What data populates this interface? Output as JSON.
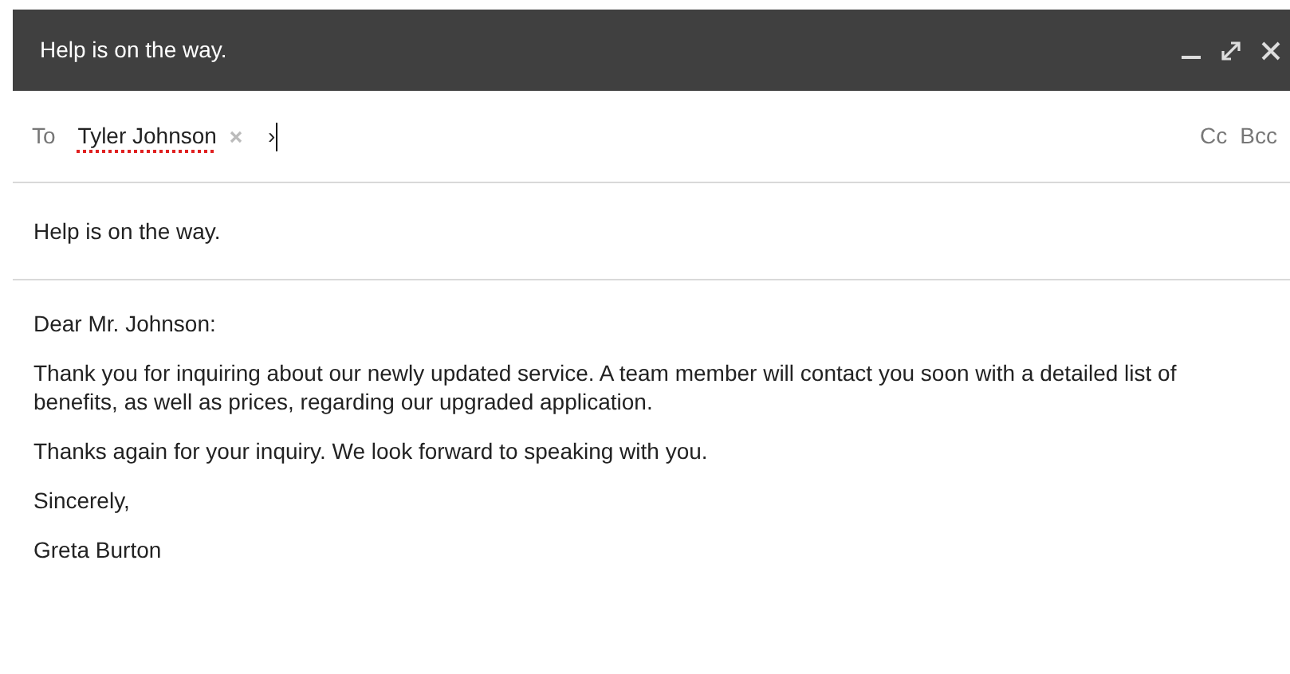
{
  "window": {
    "title": "Help is on the way."
  },
  "recipients": {
    "label": "To",
    "chips": [
      {
        "name": "Tyler Johnson",
        "misspelled": true
      }
    ],
    "typed": "›",
    "cc": "Cc",
    "bcc": "Bcc"
  },
  "subject": "Help is on the way.",
  "body": [
    "Dear Mr. Johnson:",
    "Thank you for inquiring about our newly updated service. A team member will contact you soon with a detailed list of benefits, as well as prices, regarding our upgraded application.",
    "Thanks again for your inquiry. We look forward to speaking with you.",
    "Sincerely,",
    "Greta Burton"
  ]
}
